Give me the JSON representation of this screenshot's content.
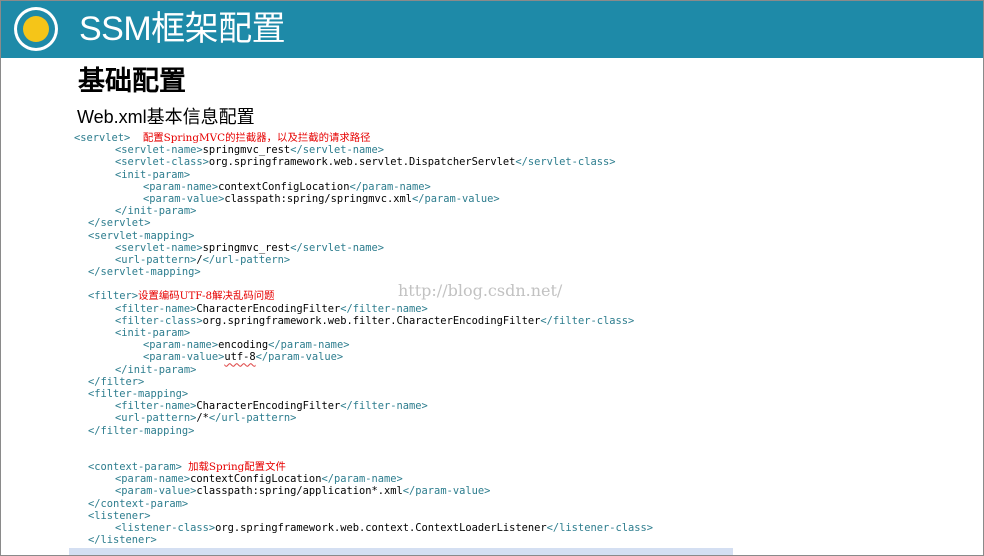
{
  "slide": {
    "title": "SSM框架配置",
    "heading": "基础配置",
    "subheading": "Web.xml基本信息配置",
    "watermark": "http://blog.csdn.net/"
  },
  "code": {
    "servlet": {
      "open": "<servlet>",
      "comment": "配置SpringMVC的拦截器，以及拦截的请求路径",
      "name_open": "<servlet-name>",
      "name_value": "springmvc_rest",
      "name_close": "</servlet-name>",
      "class_open": "<servlet-class>",
      "class_value": "org.springframework.web.servlet.DispatcherServlet",
      "class_close": "</servlet-class>",
      "init_open": "<init-param>",
      "pn_open": "<param-name>",
      "pn_value": "contextConfigLocation",
      "pn_close": "</param-name>",
      "pv_open": "<param-value>",
      "pv_value": "classpath:spring/springmvc.xml",
      "pv_close": "</param-value>",
      "init_close": "</init-param>",
      "close": "</servlet>"
    },
    "servlet_mapping": {
      "open": "<servlet-mapping>",
      "name_open": "<servlet-name>",
      "name_value": "springmvc_rest",
      "name_close": "</servlet-name>",
      "url_open": "<url-pattern>",
      "url_value": "/",
      "url_close": "</url-pattern>",
      "close": "</servlet-mapping>"
    },
    "filter": {
      "open": "<filter>",
      "comment": "设置编码UTF-8解决乱码问题",
      "name_open": "<filter-name>",
      "name_value": "CharacterEncodingFilter",
      "name_close": "</filter-name>",
      "class_open": "<filter-class>",
      "class_value": "org.springframework.web.filter.CharacterEncodingFilter",
      "class_close": "</filter-class>",
      "init_open": "<init-param>",
      "pn_open": "<param-name>",
      "pn_value": "encoding",
      "pn_close": "</param-name>",
      "pv_open": "<param-value>",
      "pv_value": "utf-8",
      "pv_close": "</param-value>",
      "init_close": "</init-param>",
      "close": "</filter>"
    },
    "filter_mapping": {
      "open": "<filter-mapping>",
      "name_open": "<filter-name>",
      "name_value": "CharacterEncodingFilter",
      "name_close": "</filter-name>",
      "url_open": "<url-pattern>",
      "url_value": "/*",
      "url_close": "</url-pattern>",
      "close": "</filter-mapping>"
    },
    "context_param": {
      "open": "<context-param>",
      "comment": "加载Spring配置文件",
      "pn_open": "<param-name>",
      "pn_value": "contextConfigLocation",
      "pn_close": "</param-name>",
      "pv_open": "<param-value>",
      "pv_value": "classpath:spring/application*.xml",
      "pv_close": "</param-value>",
      "close": "</context-param>"
    },
    "listener": {
      "open": "<listener>",
      "class_open": "<listener-class>",
      "class_value": "org.springframework.web.context.ContextLoaderListener",
      "class_close": "</listener-class>",
      "close": "</listener>"
    }
  },
  "colors": {
    "title_bar": "#1e8aa8",
    "title_dot": "#f5c518",
    "xml_tag": "#2d7d8e",
    "comment": "#e60000",
    "watermark": "#c2c2c2"
  }
}
